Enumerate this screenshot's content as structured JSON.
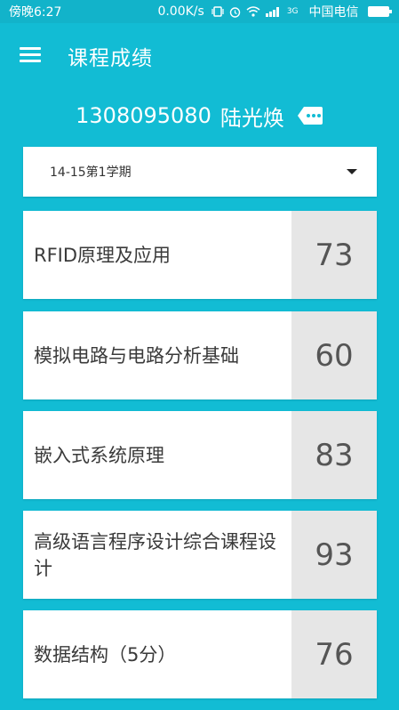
{
  "status_bar": {
    "time": "傍晚6:27",
    "net_speed": "0.00K/s",
    "carrier": "中国电信",
    "signal_label": "3G"
  },
  "app_bar": {
    "title": "课程成绩"
  },
  "student": {
    "id": "1308095080",
    "name": "陆光焕"
  },
  "semester": {
    "selected": "14-15第1学期"
  },
  "courses": [
    {
      "name": "RFID原理及应用",
      "score": "73"
    },
    {
      "name": "模拟电路与电路分析基础",
      "score": "60"
    },
    {
      "name": "嵌入式系统原理",
      "score": "83"
    },
    {
      "name": "高级语言程序设计综合课程设计",
      "score": "93"
    },
    {
      "name": "数据结构（5分）",
      "score": "76"
    }
  ],
  "colors": {
    "background": "#12bcd4",
    "card": "#ffffff",
    "score_cell": "#e6e6e6"
  }
}
